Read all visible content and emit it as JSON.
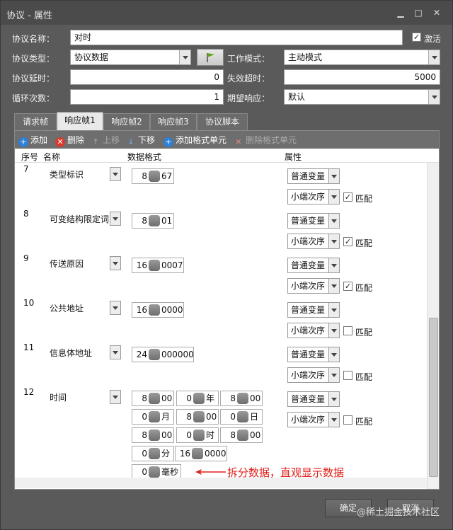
{
  "window": {
    "title": "协议 - 属性",
    "controls": {
      "minimize": "▁",
      "maximize": "□",
      "close": "✕"
    }
  },
  "form": {
    "name_label": "协议名称：",
    "name_value": "对时",
    "active_label": "激活",
    "active_checked": "✓",
    "type_label": "协议类型：",
    "type_value": "协议数据",
    "work_mode_label": "工作模式：",
    "work_mode_value": "主动模式",
    "delay_label": "协议延时：",
    "delay_value": "0",
    "timeout_label": "失效超时：",
    "timeout_value": "5000",
    "loop_label": "循环次数：",
    "loop_value": "1",
    "expect_label": "期望响应：",
    "expect_value": "默认"
  },
  "tabs": [
    {
      "label": "请求帧"
    },
    {
      "label": "响应帧1"
    },
    {
      "label": "响应帧2"
    },
    {
      "label": "响应帧3"
    },
    {
      "label": "协议脚本"
    }
  ],
  "toolbar": {
    "add": "添加",
    "delete": "删除",
    "move_up": "上移",
    "move_down": "下移",
    "add_format": "添加格式单元",
    "delete_format": "删除格式单元"
  },
  "grid": {
    "headers": {
      "index": "序号",
      "name": "名称",
      "format": "数据格式",
      "attr": "属性"
    },
    "rows": [
      {
        "index": "7",
        "name": "类型标识",
        "bits": "8",
        "value": "67",
        "var_type": "普通变量",
        "order": "小端次序",
        "match_label": "匹配",
        "match": "✓"
      },
      {
        "index": "8",
        "name": "可变结构限定词",
        "bits": "8",
        "value": "01",
        "var_type": "普通变量",
        "order": "小端次序",
        "match_label": "匹配",
        "match": "✓"
      },
      {
        "index": "9",
        "name": "传送原因",
        "bits": "16",
        "value": "0007",
        "var_type": "普通变量",
        "order": "小端次序",
        "match_label": "匹配",
        "match": "✓"
      },
      {
        "index": "10",
        "name": "公共地址",
        "bits": "16",
        "value": "0000",
        "var_type": "普通变量",
        "order": "小端次序",
        "match_label": "匹配",
        "match": ""
      },
      {
        "index": "11",
        "name": "信息体地址",
        "bits": "24",
        "value": "000000",
        "var_type": "普通变量",
        "order": "小端次序",
        "match_label": "匹配",
        "match": ""
      },
      {
        "index": "12",
        "name": "时间",
        "var_type": "普通变量",
        "order": "小端次序",
        "match_label": "匹配",
        "match": ""
      }
    ],
    "time_cells": [
      {
        "bits": "8",
        "unit": "00"
      },
      {
        "bits": "0",
        "unit": "年"
      },
      {
        "bits": "8",
        "unit": "00"
      },
      {
        "bits": "0",
        "unit": "月"
      },
      {
        "bits": "8",
        "unit": "00"
      },
      {
        "bits": "0",
        "unit": "日"
      },
      {
        "bits": "8",
        "unit": "00"
      },
      {
        "bits": "0",
        "unit": "时"
      },
      {
        "bits": "8",
        "unit": "00"
      },
      {
        "bits": "0",
        "unit": "分"
      },
      {
        "bits": "16",
        "unit": "0000"
      },
      {
        "bits": "0",
        "unit": "毫秒"
      }
    ]
  },
  "annotation": "拆分数据，直观显示数据",
  "buttons": {
    "ok": "确定",
    "cancel": "取消"
  },
  "watermark": "@稀土掘金技术社区"
}
